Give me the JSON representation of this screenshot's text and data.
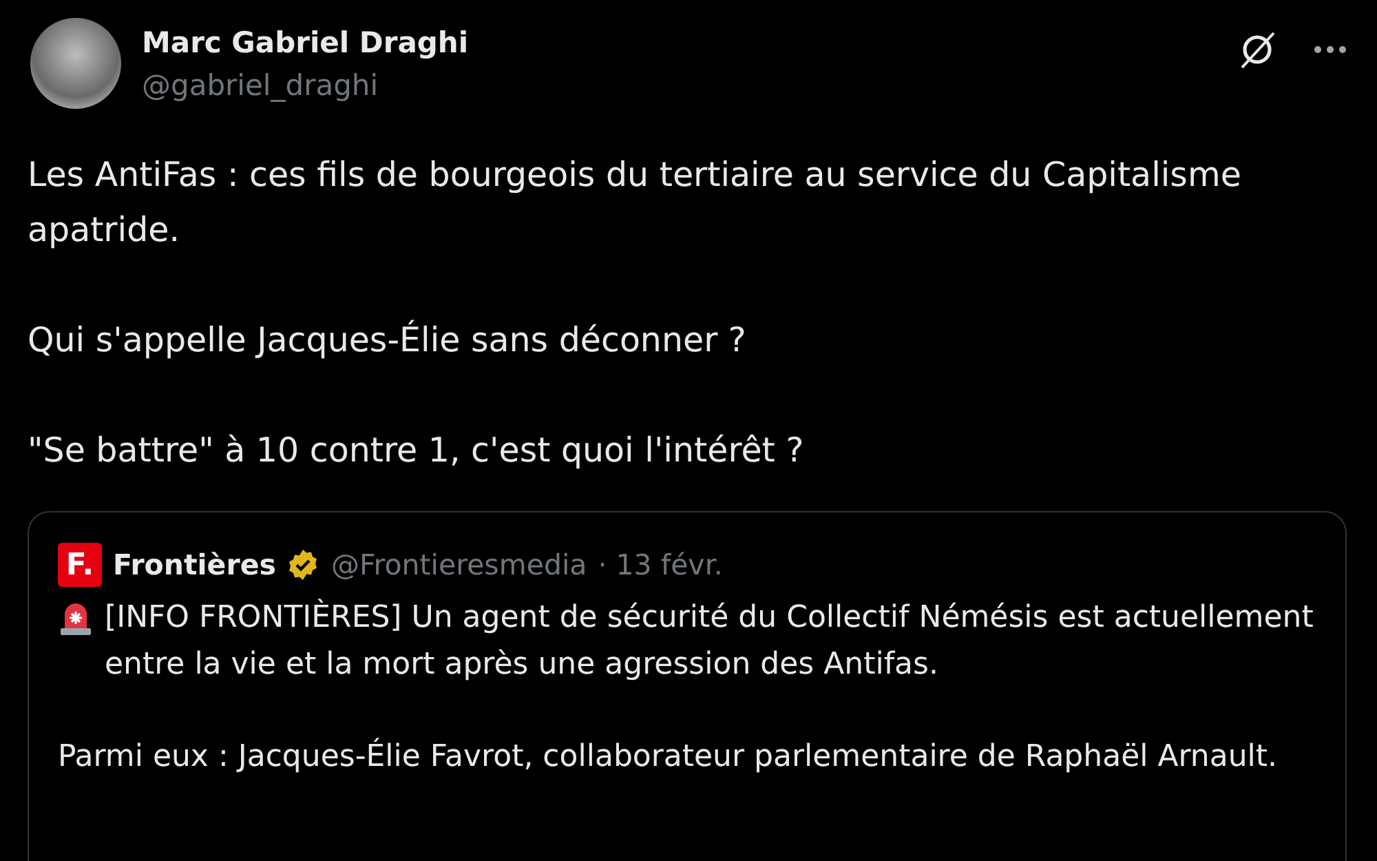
{
  "author": {
    "name": "Marc Gabriel Draghi",
    "handle": "@gabriel_draghi"
  },
  "body": [
    "Les AntiFas : ces fils de bourgeois du tertiaire au service du Capitalisme apatride.",
    "Qui s'appelle Jacques-Élie sans déconner ?",
    "\"Se battre\" à 10 contre 1, c'est quoi l'intérêt ?"
  ],
  "quote": {
    "logo_text": "F.",
    "name": "Frontières",
    "verified": true,
    "handle": "@Frontieresmedia",
    "date": "· 13 févr.",
    "paragraphs": [
      {
        "kind": "siren",
        "text": "[INFO FRONTIÈRES] Un agent de sécurité du Collectif Némésis est actuellement entre la vie et la mort après une agression des Antifas."
      },
      {
        "kind": "plain",
        "text": "Parmi eux : Jacques-Élie Favrot, collaborateur parlementaire de Raphaël Arnault."
      }
    ]
  }
}
